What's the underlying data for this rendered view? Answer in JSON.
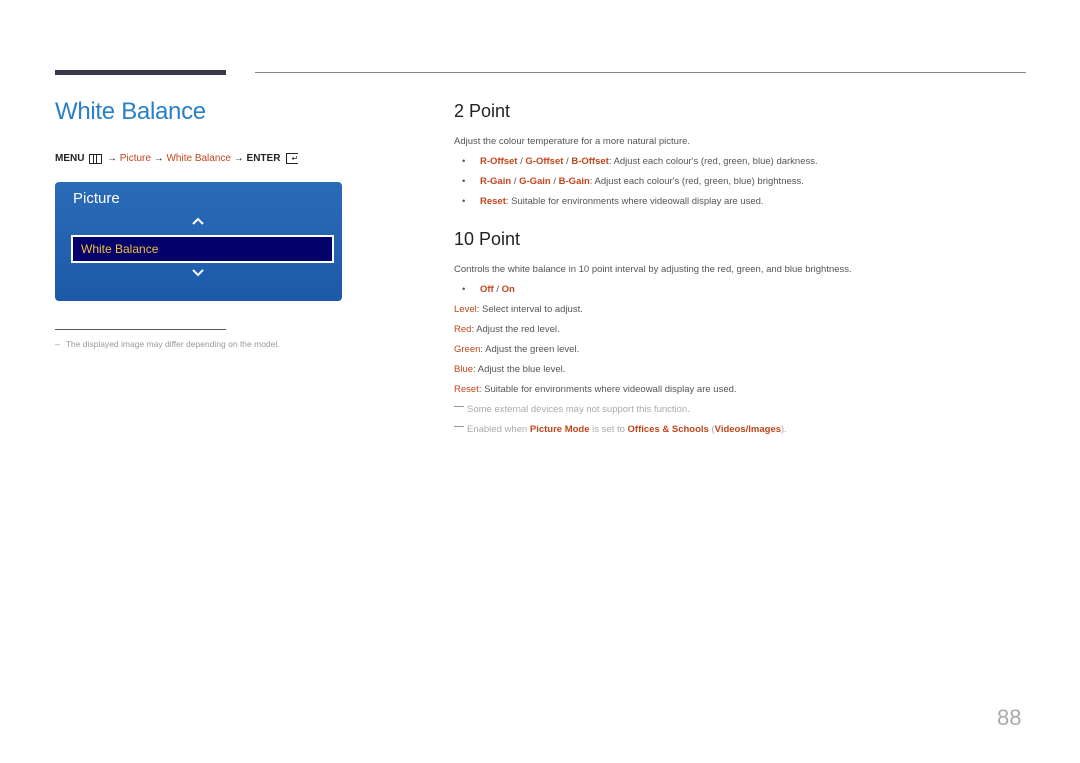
{
  "page": {
    "title": "White Balance",
    "page_number": "88"
  },
  "breadcrumb": {
    "menu": "MENU",
    "arrow": "→",
    "picture": "Picture",
    "white_balance": "White Balance",
    "enter": "ENTER"
  },
  "osd": {
    "title": "Picture",
    "selected_item": "White Balance",
    "up_icon": "chevron-up-icon",
    "down_icon": "chevron-down-icon"
  },
  "footnote": {
    "dash": "–",
    "text": "The displayed image may differ depending on the model."
  },
  "two_point": {
    "heading": "2 Point",
    "intro": "Adjust the colour temperature for a more natural picture.",
    "bullets": [
      {
        "terms": [
          "R-Offset",
          "G-Offset",
          "B-Offset"
        ],
        "separator": " / ",
        "text": ": Adjust each colour's (red, green, blue) darkness."
      },
      {
        "terms": [
          "R-Gain",
          "G-Gain",
          "B-Gain"
        ],
        "separator": " / ",
        "text": ": Adjust each colour's (red, green, blue) brightness."
      },
      {
        "terms": [
          "Reset"
        ],
        "text": ": Suitable for environments where videowall display are used."
      }
    ]
  },
  "ten_point": {
    "heading": "10 Point",
    "intro": "Controls the white balance in 10 point interval by adjusting the red, green, and blue brightness.",
    "toggle": {
      "off": "Off",
      "separator": " / ",
      "on": "On"
    },
    "items": [
      {
        "term": "Level",
        "text": ": Select interval to adjust."
      },
      {
        "term": "Red",
        "text": ": Adjust the red level."
      },
      {
        "term": "Green",
        "text": ": Adjust the green level."
      },
      {
        "term": "Blue",
        "text": ": Adjust the blue level."
      },
      {
        "term": "Reset",
        "text": ": Suitable for environments where videowall display are used."
      }
    ],
    "notes": {
      "note1": "Some external devices may not support this function.",
      "note2_prefix": "Enabled when ",
      "note2_term1": "Picture Mode",
      "note2_mid": " is set to ",
      "note2_term2": "Offices & Schools",
      "note2_paren_open": " (",
      "note2_term3": "Videos/Images",
      "note2_end": ")."
    }
  }
}
